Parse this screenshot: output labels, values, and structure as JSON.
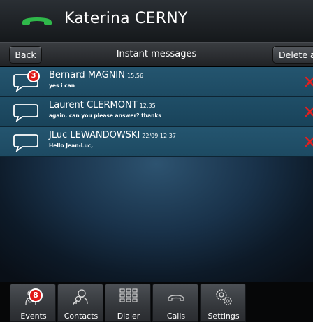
{
  "header": {
    "contact_name": "Katerina CERNY",
    "status_icon": "phone-handset-icon",
    "accent": "#2fb84a"
  },
  "navbar": {
    "back_label": "Back",
    "title": "Instant messages",
    "delete_all_label": "Delete all"
  },
  "messages": [
    {
      "sender": "Bernard MAGNIN",
      "time": "15:56",
      "preview": "yes i can",
      "unread": "3"
    },
    {
      "sender": "Laurent CLERMONT",
      "time": "12:35",
      "preview": "again. can you please answer? thanks",
      "unread": ""
    },
    {
      "sender": "JLuc LEWANDOWSKI",
      "time": "22/09 12:37",
      "preview": "Hello Jean-Luc,",
      "unread": ""
    }
  ],
  "tabs": [
    {
      "label": "Events",
      "icon": "events-icon",
      "badge": "8"
    },
    {
      "label": "Contacts",
      "icon": "contacts-icon",
      "badge": ""
    },
    {
      "label": "Dialer",
      "icon": "dialer-icon",
      "badge": ""
    },
    {
      "label": "Calls",
      "icon": "calls-icon",
      "badge": ""
    },
    {
      "label": "Settings",
      "icon": "settings-icon",
      "badge": ""
    }
  ],
  "colors": {
    "badge": "#e01818",
    "delete_x": "#e02020",
    "row": "#1f4e67"
  }
}
